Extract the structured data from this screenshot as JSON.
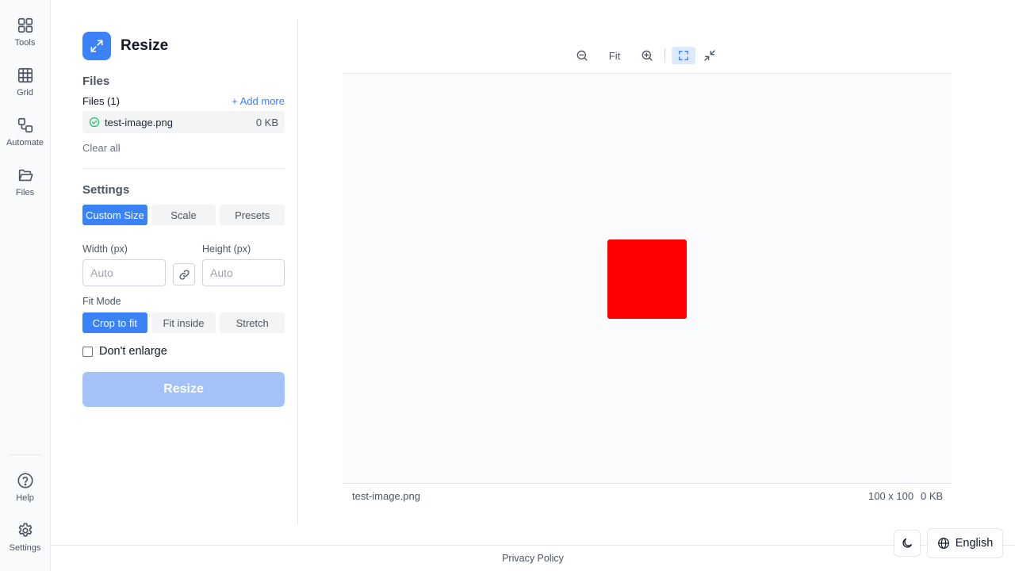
{
  "nav": {
    "items": [
      {
        "label": "Tools",
        "icon": "grid-2x2-icon"
      },
      {
        "label": "Grid",
        "icon": "grid-3x3-icon"
      },
      {
        "label": "Automate",
        "icon": "workflow-icon"
      },
      {
        "label": "Files",
        "icon": "folder-open-icon"
      }
    ],
    "bottom": [
      {
        "label": "Help",
        "icon": "help-circle-icon"
      },
      {
        "label": "Settings",
        "icon": "gear-icon"
      }
    ]
  },
  "tool": {
    "title": "Resize",
    "icon": "expand-arrows-icon",
    "accent": "#3b82f6"
  },
  "files": {
    "section_title": "Files",
    "count_label": "Files (1)",
    "add_more": "+ Add more",
    "list": [
      {
        "name": "test-image.png",
        "size": "0 KB",
        "status": "ready"
      }
    ],
    "clear_all": "Clear all"
  },
  "settings": {
    "section_title": "Settings",
    "modes": [
      "Custom Size",
      "Scale",
      "Presets"
    ],
    "active_mode": "Custom Size",
    "width_label": "Width (px)",
    "width_placeholder": "Auto",
    "height_label": "Height (px)",
    "height_placeholder": "Auto",
    "fit_mode_label": "Fit Mode",
    "fit_modes": [
      "Crop to fit",
      "Fit inside",
      "Stretch"
    ],
    "active_fit_mode": "Crop to fit",
    "dont_enlarge_label": "Don't enlarge",
    "dont_enlarge_checked": false,
    "submit_label": "Resize",
    "submit_disabled": true
  },
  "preview": {
    "toolbar": {
      "zoom_out_icon": "zoom-out-icon",
      "fit_label": "Fit",
      "zoom_in_icon": "zoom-in-icon",
      "fullscreen_icon": "fullscreen-icon",
      "collapse_icon": "minimize-icon"
    },
    "image_color": "#ff0000",
    "file_name": "test-image.png",
    "dimensions": "100 x 100",
    "size": "0 KB"
  },
  "footer": {
    "privacy_label": "Privacy Policy",
    "theme_icon": "moon-icon",
    "language": "English"
  }
}
